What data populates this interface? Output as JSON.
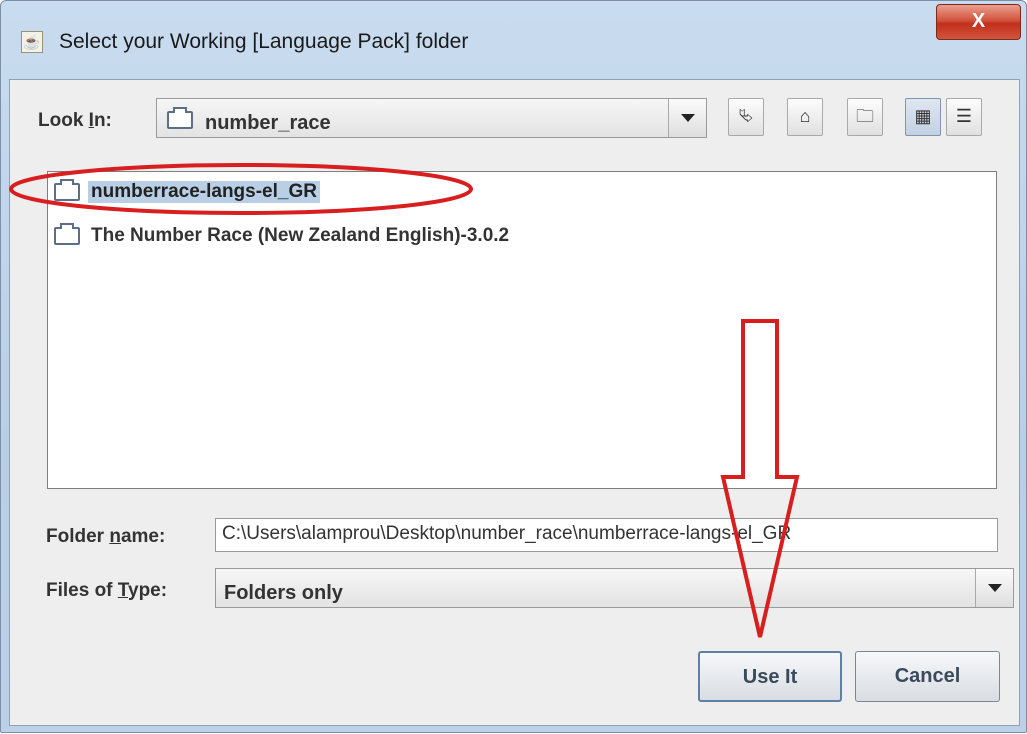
{
  "window": {
    "title": "Select your Working [Language Pack] folder",
    "close_label": "X"
  },
  "look_in": {
    "label_prefix": "Look ",
    "label_mnemonic": "I",
    "label_suffix": "n:",
    "value": "number_race",
    "toolbar_icons": [
      "up-one-level-icon",
      "home-icon",
      "new-folder-icon",
      "list-view-icon",
      "details-view-icon"
    ]
  },
  "files": [
    {
      "name": "numberrace-langs-el_GR",
      "selected": true
    },
    {
      "name": "The Number Race (New Zealand English)-3.0.2",
      "selected": false
    }
  ],
  "folder_name": {
    "label_prefix": "Folder ",
    "label_mnemonic": "n",
    "label_suffix": "ame:",
    "value": "C:\\Users\\alamprou\\Desktop\\number_race\\numberrace-langs-el_GR"
  },
  "files_of_type": {
    "label_prefix": "Files of ",
    "label_mnemonic": "T",
    "label_suffix": "ype:",
    "value": "Folders only"
  },
  "buttons": {
    "use_it": "Use It",
    "cancel": "Cancel"
  },
  "colors": {
    "annotation": "#d81e1e",
    "selection": "#b8cfe5",
    "close_button": "#c8402a"
  }
}
